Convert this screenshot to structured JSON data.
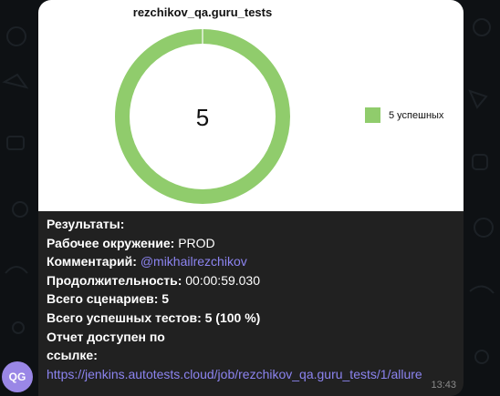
{
  "sender": {
    "initials": "QG"
  },
  "chart_data": {
    "type": "pie",
    "title": "rezchikov_qa.guru_tests",
    "center_label": "5",
    "series": [
      {
        "name": "5 успешных",
        "values": [
          5
        ],
        "color": "#90cc6c"
      }
    ],
    "legend": "right"
  },
  "message": {
    "lines": [
      {
        "label": "Результаты:",
        "value": ""
      },
      {
        "label": "Рабочее окружение:",
        "value": " PROD"
      },
      {
        "label": "Комментарий:",
        "value": "",
        "link": " @mikhailrezchikov"
      },
      {
        "label": "Продолжительность:",
        "value": " 00:00:59.030"
      },
      {
        "label": "Всего сценариев: 5",
        "value": ""
      },
      {
        "label": "Всего успешных тестов: 5 (100 %)",
        "value": ""
      },
      {
        "label": "Отчет доступен по",
        "value": ""
      },
      {
        "label": "ссылке:",
        "value": "",
        "link": " https://jenkins.autotests.cloud/job/rezchikov_qa.guru_tests/1/allure"
      }
    ],
    "time": "13:43"
  },
  "colors": {
    "accent": "#8c84f0",
    "success": "#90cc6c",
    "avatar": "#9a87e6"
  }
}
